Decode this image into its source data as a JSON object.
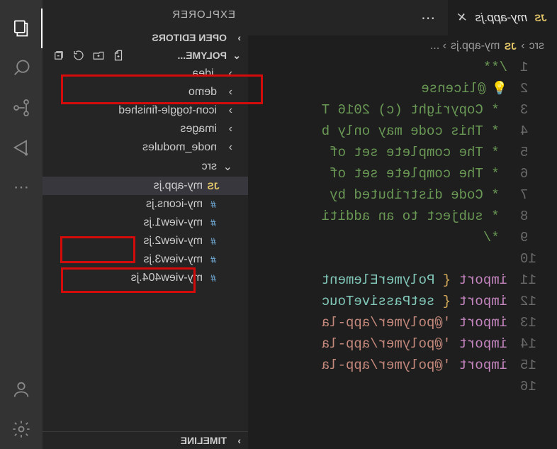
{
  "sidebar": {
    "title": "EXPLORER",
    "openEditors": "OPEN EDITORS",
    "project": "POLYME...",
    "timeline": "TIMELINE",
    "tree": [
      {
        "kind": "folder",
        "label": ".idea",
        "depth": 1,
        "expanded": false
      },
      {
        "kind": "folder",
        "label": "demo",
        "depth": 1,
        "expanded": false
      },
      {
        "kind": "folder",
        "label": "icon-toggle-finished",
        "depth": 1,
        "expanded": false
      },
      {
        "kind": "folder",
        "label": "images",
        "depth": 1,
        "expanded": false
      },
      {
        "kind": "folder",
        "label": "node_modules",
        "depth": 1,
        "expanded": false
      },
      {
        "kind": "folder",
        "label": "src",
        "depth": 1,
        "expanded": true
      },
      {
        "kind": "file",
        "label": "my-app.js",
        "depth": 2,
        "icon": "js",
        "active": true
      },
      {
        "kind": "file",
        "label": "my-icons.js",
        "depth": 2,
        "icon": "hash"
      },
      {
        "kind": "file",
        "label": "my-view1.js",
        "depth": 2,
        "icon": "hash"
      },
      {
        "kind": "file",
        "label": "my-view2.js",
        "depth": 2,
        "icon": "hash"
      },
      {
        "kind": "file",
        "label": "my-view3.js",
        "depth": 2,
        "icon": "hash"
      },
      {
        "kind": "file",
        "label": "my-view404.js",
        "depth": 2,
        "icon": "hash"
      }
    ]
  },
  "tab": {
    "icon": "JS",
    "label": "my-app.js",
    "overflow": "⋯"
  },
  "breadcrumb": {
    "part1": "src",
    "sep": "›",
    "icon": "JS",
    "part2": "my-app.js",
    "tail": "› ..."
  },
  "code": {
    "lines": [
      {
        "n": 1,
        "seg": [
          {
            "c": "tok-comment",
            "t": "/**"
          }
        ]
      },
      {
        "n": 2,
        "bulb": true,
        "seg": [
          {
            "c": "tok-comment",
            "t": "@license"
          }
        ]
      },
      {
        "n": 3,
        "seg": [
          {
            "c": "tok-comment",
            "t": " * Copyright (c) 2016 T"
          }
        ]
      },
      {
        "n": 4,
        "seg": [
          {
            "c": "tok-comment",
            "t": " * This code may only b"
          }
        ]
      },
      {
        "n": 5,
        "seg": [
          {
            "c": "tok-comment",
            "t": " * The complete set of "
          }
        ]
      },
      {
        "n": 6,
        "seg": [
          {
            "c": "tok-comment",
            "t": " * The complete set of "
          }
        ]
      },
      {
        "n": 7,
        "seg": [
          {
            "c": "tok-comment",
            "t": " * Code distributed by "
          }
        ]
      },
      {
        "n": 8,
        "seg": [
          {
            "c": "tok-comment",
            "t": " * subject to an additi"
          }
        ]
      },
      {
        "n": 9,
        "seg": [
          {
            "c": "tok-comment",
            "t": " */"
          }
        ]
      },
      {
        "n": 10,
        "seg": []
      },
      {
        "n": 11,
        "seg": [
          {
            "c": "tok-keyword",
            "t": "import "
          },
          {
            "c": "tok-brace",
            "t": "{ "
          },
          {
            "c": "tok-ident",
            "t": "PolymerElement"
          }
        ]
      },
      {
        "n": 12,
        "seg": [
          {
            "c": "tok-keyword",
            "t": "import "
          },
          {
            "c": "tok-brace",
            "t": "{ "
          },
          {
            "c": "tok-ident",
            "t": "setPassiveTouc"
          }
        ]
      },
      {
        "n": 13,
        "seg": [
          {
            "c": "tok-keyword",
            "t": "import "
          },
          {
            "c": "tok-string",
            "t": "'@polymer/app-la"
          }
        ]
      },
      {
        "n": 14,
        "seg": [
          {
            "c": "tok-keyword",
            "t": "import "
          },
          {
            "c": "tok-string",
            "t": "'@polymer/app-la"
          }
        ]
      },
      {
        "n": 15,
        "seg": [
          {
            "c": "tok-keyword",
            "t": "import "
          },
          {
            "c": "tok-string",
            "t": "'@polymer/app-la"
          }
        ]
      },
      {
        "n": 16,
        "seg": []
      }
    ]
  }
}
